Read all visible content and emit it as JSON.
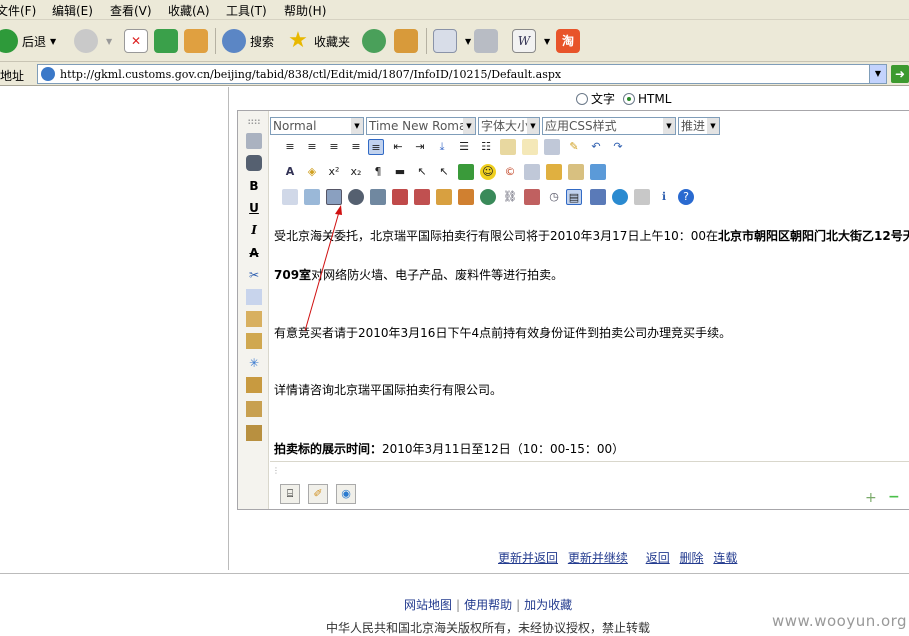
{
  "menu": [
    "文件(F)",
    "编辑(E)",
    "查看(V)",
    "收藏(A)",
    "工具(T)",
    "帮助(H)"
  ],
  "toolbar": {
    "back": "后退",
    "search": "搜索",
    "favorites": "收藏夹"
  },
  "address": {
    "label": "地址",
    "url": "http://gkml.customs.gov.cn/beijing/tabid/838/ctl/Edit/mid/1807/InfoID/10215/Default.aspx"
  },
  "editor": {
    "mode_text": "文字",
    "mode_html": "HTML",
    "format_select": "Normal",
    "font_select": "Time New Roman",
    "size_select": "字体大小",
    "css_select": "应用CSS样式",
    "indent_select": "推进",
    "content": {
      "p1_normal": "受北京海关委托，北京瑞平国际拍卖行有限公司将于2010年3月17日上午10：00在",
      "p1_bold": "北京市朝阳区朝阳门北大街乙12号天",
      "p2_bold": "709室",
      "p2_normal": "对网络防火墙、电子产品、废料件等进行拍卖。",
      "p3": "有意竞买者请于2010年3月16日下午4点前持有效身份证件到拍卖公司办理竞买手续。",
      "p4": "详情请咨询北京瑞平国际拍卖行有限公司。",
      "p5_bold": "拍卖标的展示时间：",
      "p5_normal": "2010年3月11日至12日（10：00-15：00）"
    }
  },
  "actions": [
    "更新并返回",
    "更新并继续",
    "返回",
    "删除",
    "连载"
  ],
  "footer": {
    "links": [
      "网站地图",
      "使用帮助",
      "加为收藏"
    ],
    "copyright": "中华人民共和国北京海关版权所有，未经协议授权，禁止转载"
  },
  "watermark": "www.wooyun.org"
}
